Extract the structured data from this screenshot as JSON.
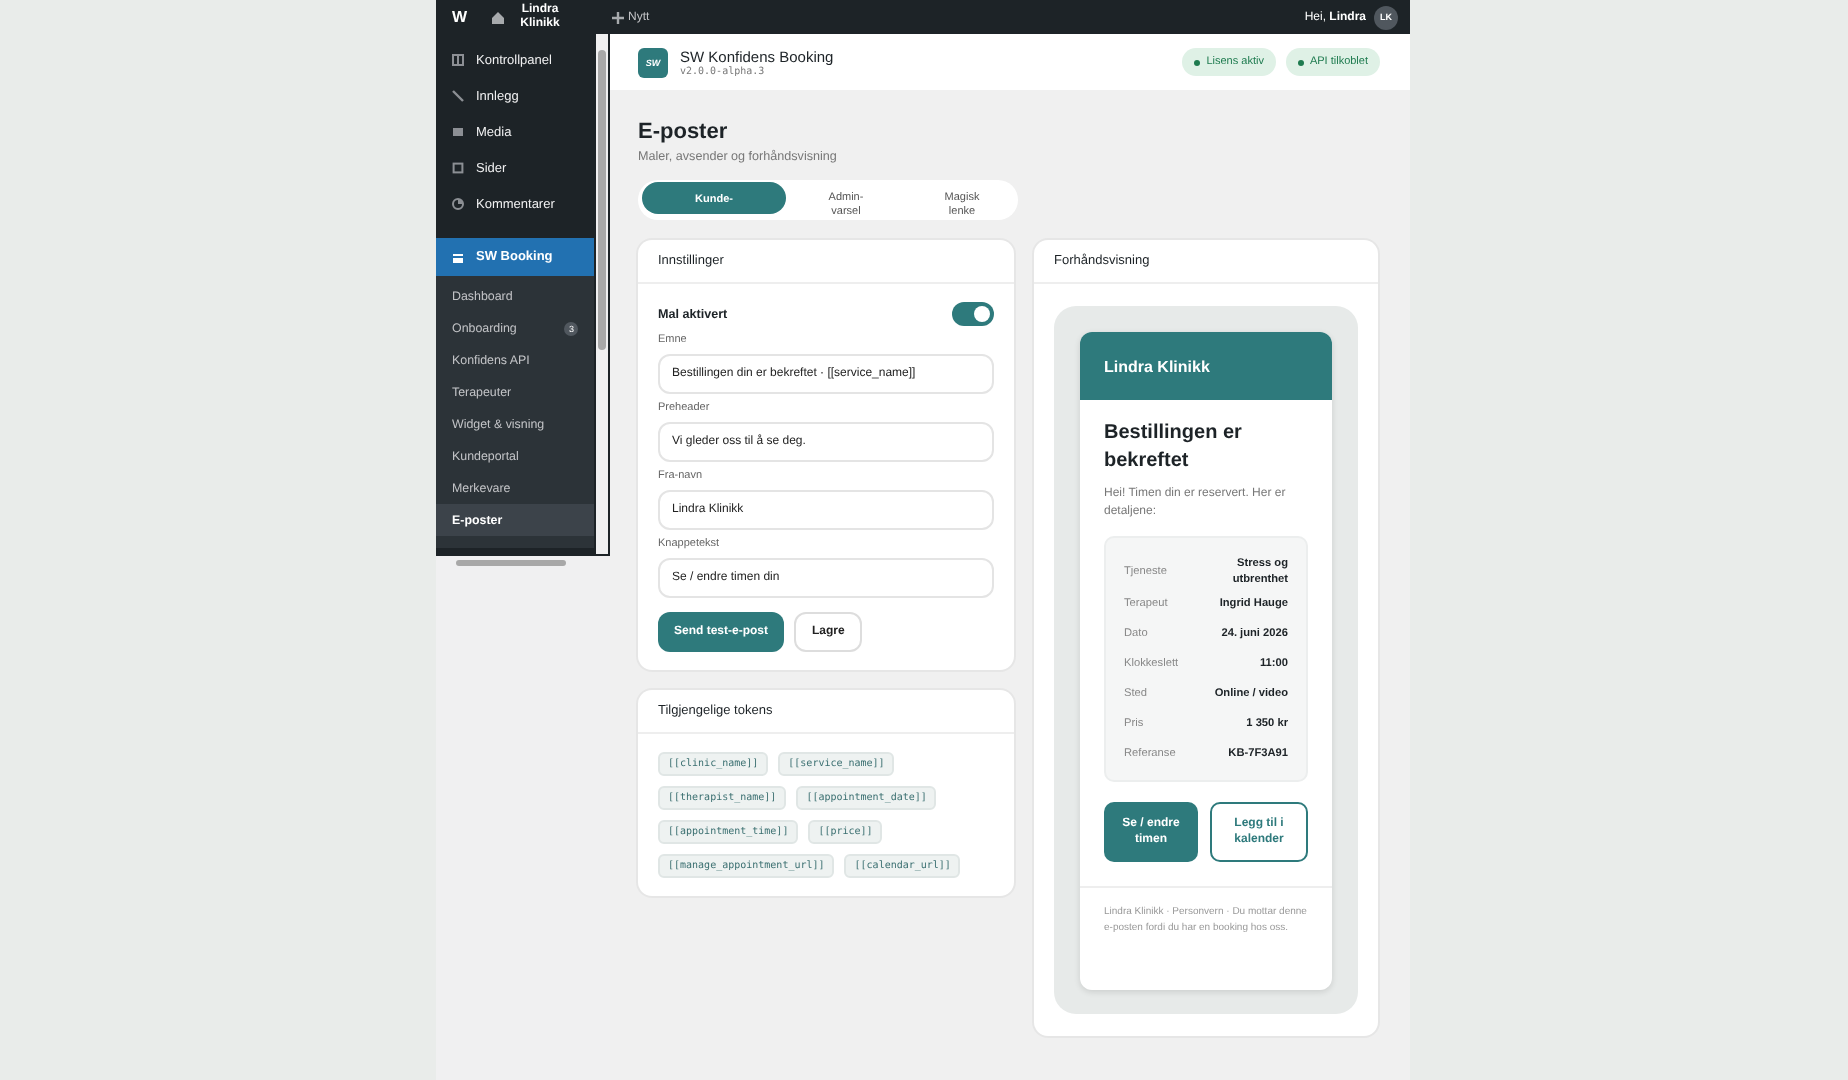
{
  "topbar": {
    "logo": "W",
    "site": "Lindra Klinikk",
    "new": "Nytt",
    "greeting": "Hei, **Lindra**",
    "avatar": "LK"
  },
  "sidebar": {
    "items": [
      {
        "label": "Kontrollpanel",
        "selected": false
      },
      {
        "label": "Innlegg",
        "selected": false
      },
      {
        "label": "Media",
        "selected": false
      },
      {
        "label": "Sider",
        "selected": false
      },
      {
        "label": "Kommentarer",
        "selected": false
      },
      {
        "label": "SW Booking",
        "selected": true
      }
    ],
    "submenu": [
      {
        "label": "Dashboard",
        "selected": false
      },
      {
        "label": "Onboarding",
        "selected": false,
        "badge": "3"
      },
      {
        "label": "Konfidens API",
        "selected": false
      },
      {
        "label": "Terapeuter",
        "selected": false
      },
      {
        "label": "Widget & visning",
        "selected": false
      },
      {
        "label": "Kundeportal",
        "selected": false
      },
      {
        "label": "Merkevare",
        "selected": false
      },
      {
        "label": "E-poster",
        "selected": true
      }
    ]
  },
  "plugin_header": {
    "logo": "SW",
    "title": "SW Konfidens Booking",
    "version": "v2.0.0-alpha.3",
    "pills": [
      "Lisens aktiv",
      "API tilkoblet"
    ]
  },
  "page": {
    "title": "E-poster",
    "subtitle": "Maler, avsender og forhåndsvisning"
  },
  "tabs": [
    {
      "label": "Kunde-",
      "selected": true
    },
    {
      "label": "Admin-\nvarsel",
      "selected": false
    },
    {
      "label": "Magisk\nlenke",
      "selected": false
    }
  ],
  "settings": {
    "title": "Innstillinger",
    "toggle": {
      "label": "Mal aktivert",
      "on": true
    },
    "fields": [
      {
        "label": "Emne",
        "value": "Bestillingen din er bekreftet · [[service_name]]"
      },
      {
        "label": "Preheader",
        "value": "Vi gleder oss til å se deg."
      },
      {
        "label": "Fra-navn",
        "value": "Lindra Klinikk"
      },
      {
        "label": "Knappetekst",
        "value": "Se / endre timen din"
      }
    ],
    "buttons": [
      {
        "label": "Send test-e-post",
        "kind": "primary"
      },
      {
        "label": "Lagre",
        "kind": "secondary"
      }
    ]
  },
  "tokens": {
    "title": "Tilgjengelige tokens",
    "items": [
      "[[clinic_name]]",
      "[[service_name]]",
      "[[therapist_name]]",
      "[[appointment_date]]",
      "[[appointment_time]]",
      "[[price]]",
      "[[manage_appointment_url]]",
      "[[calendar_url]]"
    ]
  },
  "preview": {
    "title": "Forhåndsvisning",
    "brand": "Lindra Klinikk",
    "heading": "Bestillingen er bekreftet",
    "intro": "Hei! Timen din er reservert. Her er detaljene:",
    "details": [
      {
        "label": "Tjeneste",
        "value": "Stress og utbrenthet"
      },
      {
        "label": "Terapeut",
        "value": "Ingrid Hauge"
      },
      {
        "label": "Dato",
        "value": "24. juni 2026"
      },
      {
        "label": "Klokkeslett",
        "value": "11:00"
      },
      {
        "label": "Sted",
        "value": "Online / video"
      },
      {
        "label": "Pris",
        "value": "1 350 kr"
      },
      {
        "label": "Referanse",
        "value": "KB-7F3A91"
      }
    ],
    "buttons": [
      {
        "label": "Se / endre timen",
        "kind": "primary"
      },
      {
        "label": "Legg til i kalender",
        "kind": "secondary"
      }
    ],
    "footer": "Lindra Klinikk · Personvern · Du mottar denne e-posten fordi du har en booking hos oss."
  }
}
